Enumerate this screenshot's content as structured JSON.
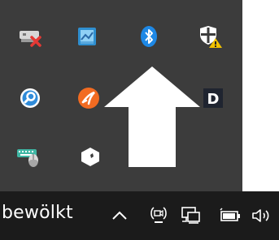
{
  "flyout": {
    "icons": [
      {
        "name": "network-error-icon"
      },
      {
        "name": "blue-app-icon"
      },
      {
        "name": "bluetooth-icon"
      },
      {
        "name": "windows-security-warning-icon"
      },
      {
        "name": "blue-circle-app-icon"
      },
      {
        "name": "orange-circle-app-icon"
      },
      {
        "name": "d-app-icon",
        "label": "D"
      },
      {
        "name": "keyboard-mouse-icon"
      },
      {
        "name": "white-box-icon"
      }
    ],
    "overlay": "white-up-arrow"
  },
  "taskbar": {
    "weather_text": "bewölkt",
    "show_hidden_icons": "chevron-up-icon",
    "tray_items": [
      "meet-now-icon",
      "network-icon",
      "battery-icon",
      "volume-icon"
    ]
  },
  "colors": {
    "flyout_bg": "#3c3c3c",
    "taskbar_bg": "#1b1b1b",
    "bluetooth_blue": "#1e88e5",
    "security_yellow": "#f2c200"
  }
}
